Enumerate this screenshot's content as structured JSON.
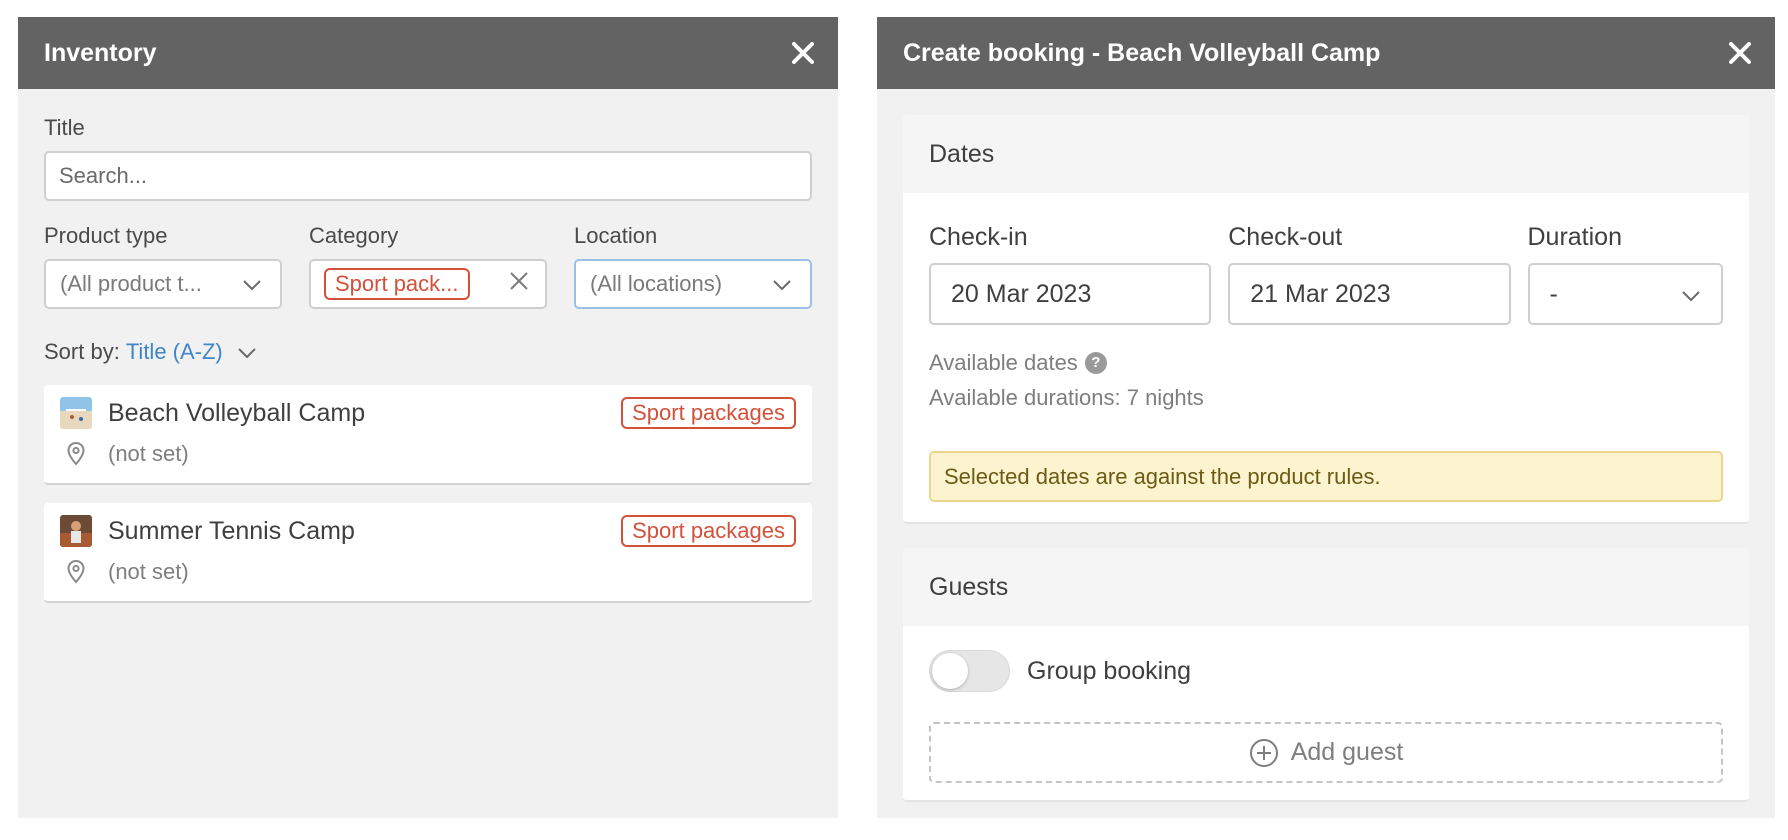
{
  "inventory": {
    "title": "Inventory",
    "title_field": {
      "label": "Title",
      "placeholder": "Search..."
    },
    "product_type": {
      "label": "Product type",
      "value": "(All product t..."
    },
    "category": {
      "label": "Category",
      "chip": "Sport pack..."
    },
    "location": {
      "label": "Location",
      "value": "(All locations)"
    },
    "sort": {
      "label": "Sort by:",
      "value": "Title (A-Z)"
    },
    "products": [
      {
        "name": "Beach Volleyball Camp",
        "tag": "Sport packages",
        "location": "(not set)"
      },
      {
        "name": "Summer Tennis Camp",
        "tag": "Sport packages",
        "location": "(not set)"
      }
    ]
  },
  "booking": {
    "title": "Create booking - Beach Volleyball Camp",
    "dates": {
      "heading": "Dates",
      "checkin": {
        "label": "Check-in",
        "value": "20 Mar 2023"
      },
      "checkout": {
        "label": "Check-out",
        "value": "21 Mar 2023"
      },
      "duration": {
        "label": "Duration",
        "value": "-"
      },
      "available_dates": "Available dates",
      "available_durations": "Available durations: 7 nights",
      "warning": "Selected dates are against the product rules."
    },
    "guests": {
      "heading": "Guests",
      "group_booking": "Group booking",
      "group_booking_on": false,
      "add_guest": "Add guest"
    }
  },
  "colors": {
    "header_bg": "#636363",
    "tag_red": "#d3513b",
    "link_blue": "#3f86c8",
    "warning_bg": "#fbf4cf"
  }
}
